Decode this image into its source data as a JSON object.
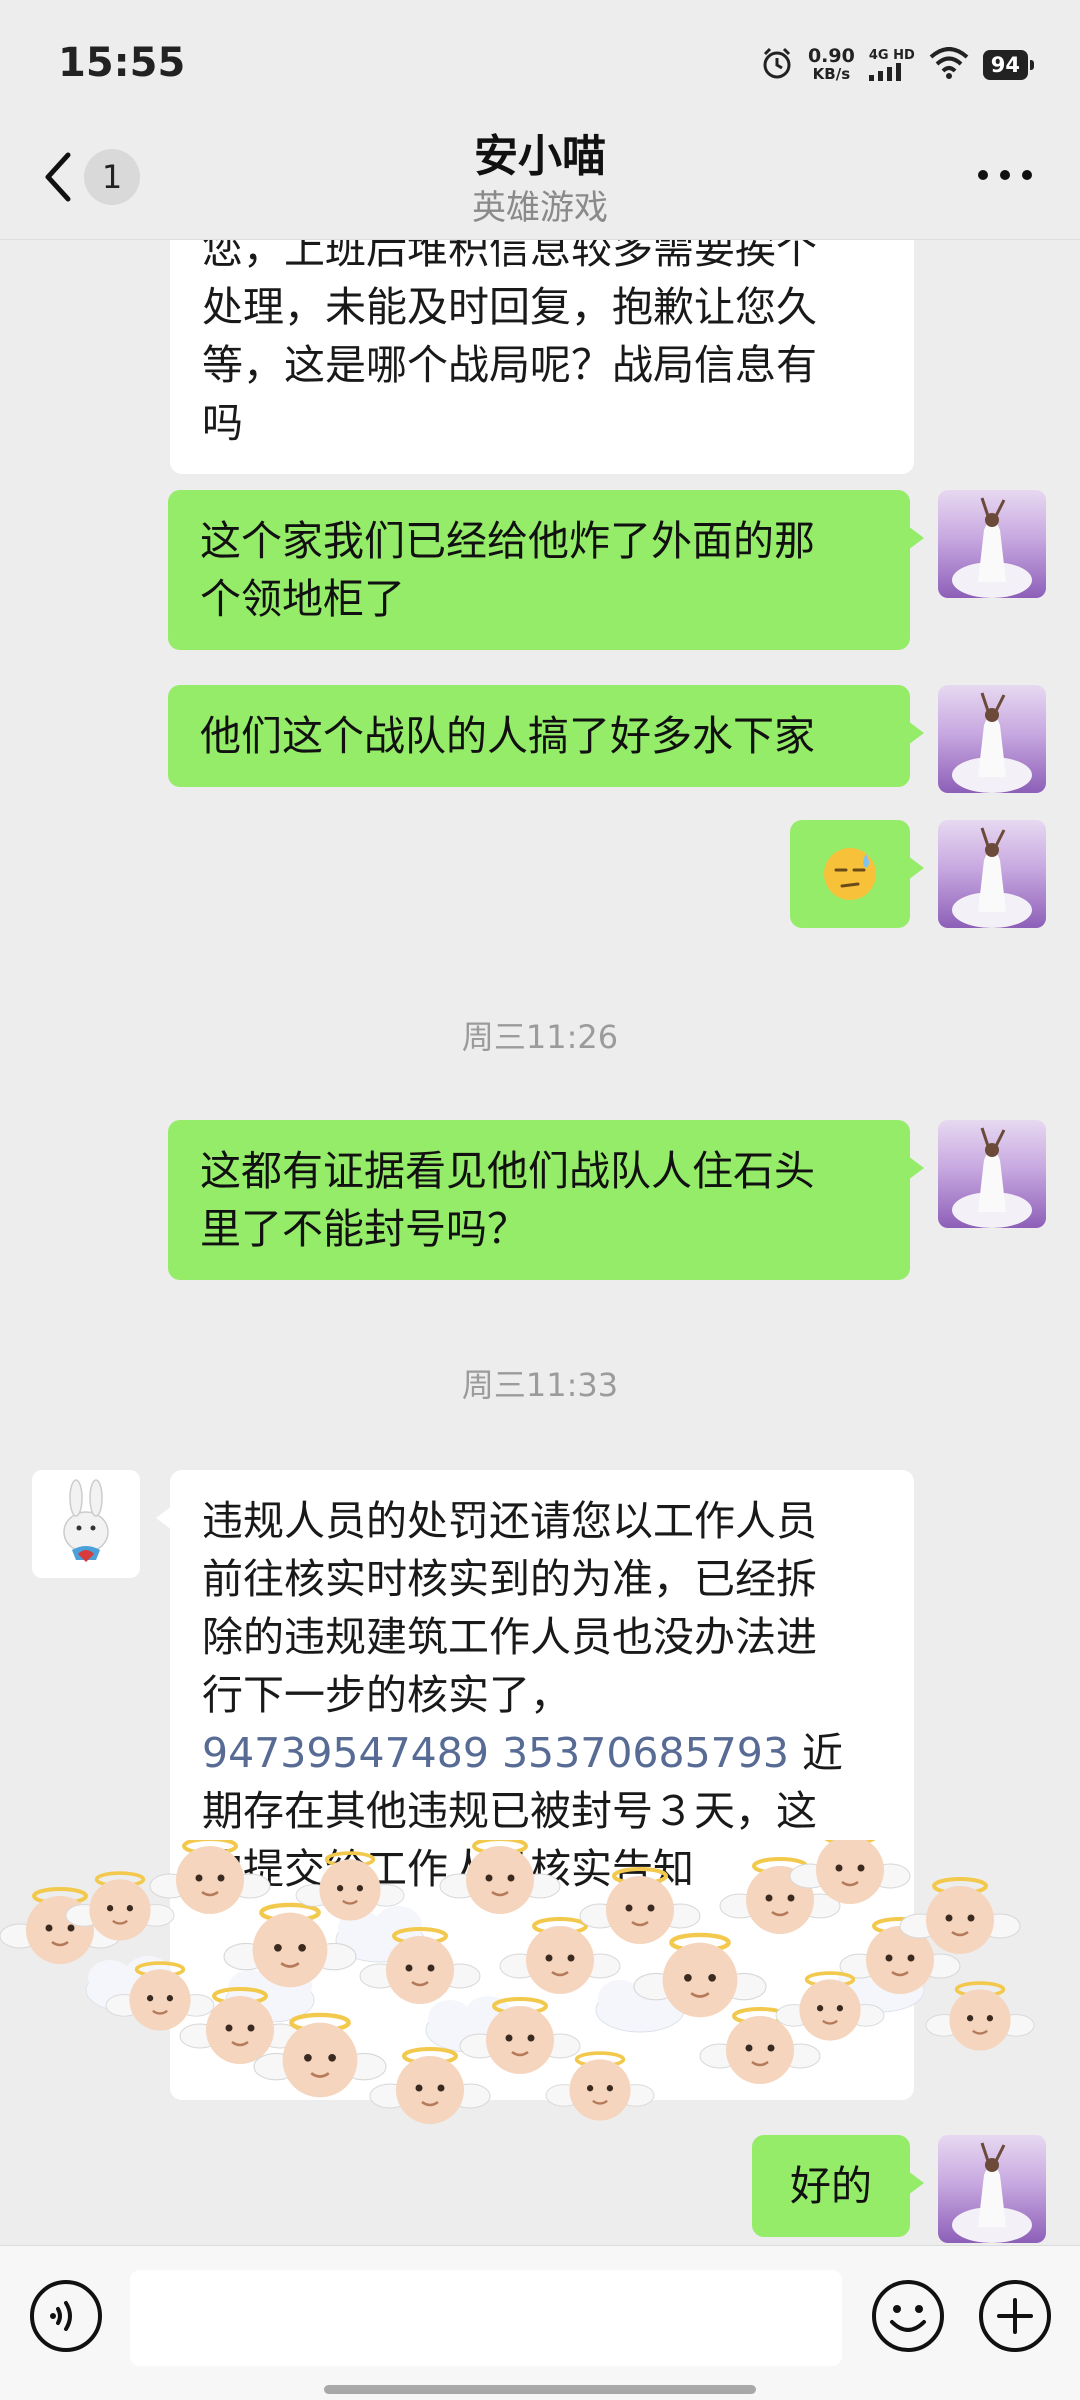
{
  "status_bar": {
    "time": "15:55",
    "net_speed_value": "0.90",
    "net_speed_unit": "KB/s",
    "signal_label": "4G HD",
    "battery": "94"
  },
  "header": {
    "unread_count": "1",
    "title": "安小喵",
    "subtitle": "英雄游戏"
  },
  "messages": {
    "m1": {
      "sender": "agent",
      "lines": [
        "您，上班后堆积信息较多需要挨个",
        "处理，未能及时回复，抱歉让您久",
        "等，这是哪个战局呢？战局信息有",
        "吗"
      ]
    },
    "m2": {
      "sender": "me",
      "lines": [
        "这个家我们已经给他炸了外面的那",
        "个领地柜了"
      ]
    },
    "m3": {
      "sender": "me",
      "text": "他们这个战队的人搞了好多水下家"
    },
    "m4": {
      "sender": "me",
      "emoji": "😓"
    },
    "ts1": "周三11:26",
    "m5": {
      "sender": "me",
      "lines": [
        "这都有证据看见他们战队人住石头",
        "里了不能封号吗？"
      ]
    },
    "ts2": "周三11:33",
    "m6": {
      "sender": "agent",
      "lines": [
        "违规人员的处罚还请您以工作人员",
        "前往核实时核实到的为准，已经拆",
        "除的违规建筑工作人员也没办法进",
        "行下一步的核实了，"
      ],
      "link_text": "94739547489 35370685793",
      "after_link": "近",
      "lines_after": [
        "期存在其他违规已被封号３天，这",
        "边提交给工作人员核实告知"
      ]
    },
    "m7": {
      "sender": "me",
      "text": "好的"
    }
  },
  "input": {
    "placeholder": ""
  },
  "effect_icon": "angel-emoji-rain"
}
